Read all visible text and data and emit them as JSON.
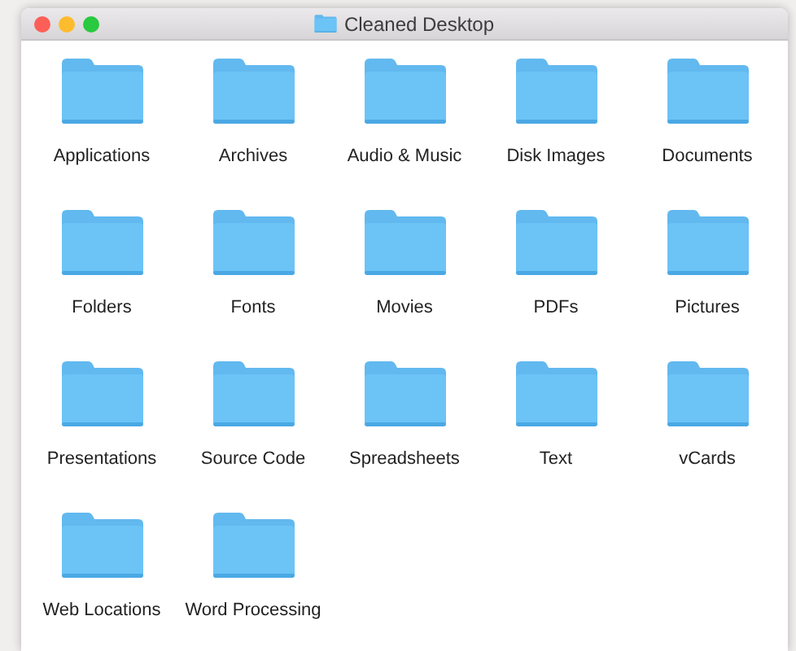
{
  "window": {
    "title": "Cleaned Desktop"
  },
  "folders": [
    {
      "name": "Applications"
    },
    {
      "name": "Archives"
    },
    {
      "name": "Audio & Music"
    },
    {
      "name": "Disk Images"
    },
    {
      "name": "Documents"
    },
    {
      "name": "Folders"
    },
    {
      "name": "Fonts"
    },
    {
      "name": "Movies"
    },
    {
      "name": "PDFs"
    },
    {
      "name": "Pictures"
    },
    {
      "name": "Presentations"
    },
    {
      "name": "Source Code"
    },
    {
      "name": "Spreadsheets"
    },
    {
      "name": "Text"
    },
    {
      "name": "vCards"
    },
    {
      "name": "Web Locations"
    },
    {
      "name": "Word Processing"
    }
  ]
}
